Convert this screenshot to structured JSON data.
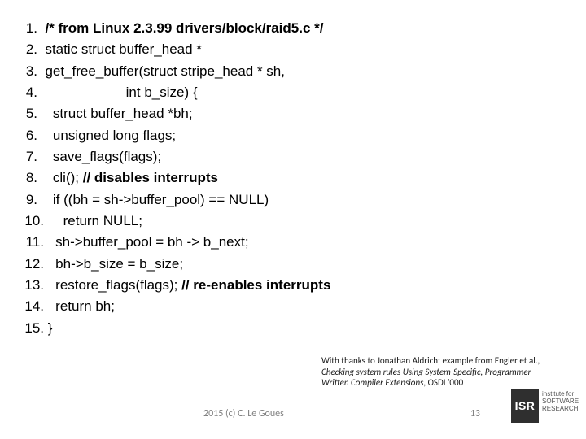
{
  "code": {
    "lines": [
      {
        "num": "1.",
        "indent": "  ",
        "segments": [
          {
            "text": "/* from Linux 2.3.99 drivers/block/raid5.c */",
            "bold": true
          }
        ]
      },
      {
        "num": "2.",
        "indent": "  ",
        "segments": [
          {
            "text": "static struct buffer_head *"
          }
        ]
      },
      {
        "num": "3.",
        "indent": "  ",
        "segments": [
          {
            "text": "get_free_buffer(struct stripe_head * sh,"
          }
        ]
      },
      {
        "num": "4.",
        "indent": "                       ",
        "segments": [
          {
            "text": "int b_size) {"
          }
        ]
      },
      {
        "num": "5.",
        "indent": "    ",
        "segments": [
          {
            "text": "struct buffer_head *bh;"
          }
        ]
      },
      {
        "num": "6.",
        "indent": "    ",
        "segments": [
          {
            "text": "unsigned long flags;"
          }
        ]
      },
      {
        "num": "7.",
        "indent": "    ",
        "segments": [
          {
            "text": "save_flags(flags);"
          }
        ]
      },
      {
        "num": "8.",
        "indent": "    ",
        "segments": [
          {
            "text": "cli(); "
          },
          {
            "text": "// disables interrupts",
            "bold": true
          }
        ]
      },
      {
        "num": "9.",
        "indent": "    ",
        "segments": [
          {
            "text": "if "
          },
          {
            "text": "((bh = sh->buffer_pool) == NULL)"
          }
        ]
      },
      {
        "num": "10.",
        "indent": "     ",
        "segments": [
          {
            "text": "return "
          },
          {
            "text": "NULL;"
          }
        ]
      },
      {
        "num": "11.",
        "indent": "   ",
        "segments": [
          {
            "text": "sh->buffer_pool = bh -> b_next;"
          }
        ]
      },
      {
        "num": "12.",
        "indent": "   ",
        "segments": [
          {
            "text": "bh->b_size = b_size;"
          }
        ]
      },
      {
        "num": "13.",
        "indent": "   ",
        "segments": [
          {
            "text": "restore_flags(flags); "
          },
          {
            "text": "// re-enables interrupts",
            "bold": true
          }
        ]
      },
      {
        "num": "14.",
        "indent": "   ",
        "segments": [
          {
            "text": "return "
          },
          {
            "text": "bh;"
          }
        ]
      },
      {
        "num": "15.",
        "indent": " ",
        "segments": [
          {
            "text": "}"
          }
        ]
      }
    ]
  },
  "credit": {
    "prefix": "With thanks to Jonathan Aldrich; example from Engler et al., ",
    "ital": "Checking system rules Using System-Specific, Programmer-Written Compiler Extensions",
    "suffix": ", OSDI '000"
  },
  "footer": {
    "copyright": "2015 (c) C. Le Goues",
    "pagenum": "13",
    "logo_badge": "ISR",
    "logo_text_1": "institute for",
    "logo_text_2": "SOFTWARE",
    "logo_text_3": "RESEARCH"
  }
}
